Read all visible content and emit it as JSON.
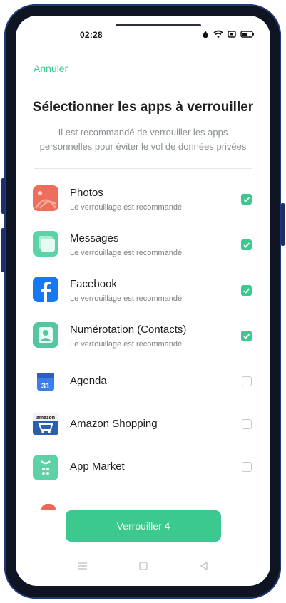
{
  "status_bar": {
    "time": "02:28"
  },
  "header": {
    "cancel_label": "Annuler",
    "title": "Sélectionner les apps à verrouiller",
    "subtitle_line1": "Il est recommandé de verrouiller les apps",
    "subtitle_line2": "personnelles pour éviter le vol de données privées"
  },
  "apps": [
    {
      "name": "Photos",
      "sub": "Le verrouillage est recommandé",
      "checked": true,
      "icon": "photos-icon",
      "color": "#ee6e5c"
    },
    {
      "name": "Messages",
      "sub": "Le verrouillage est recommandé",
      "checked": true,
      "icon": "messages-icon",
      "color": "#5dd2a6"
    },
    {
      "name": "Facebook",
      "sub": "Le verrouillage est recommandé",
      "checked": true,
      "icon": "facebook-icon",
      "color": "#1877f2"
    },
    {
      "name": "Numérotation (Contacts)",
      "sub": "Le verrouillage est recommandé",
      "checked": true,
      "icon": "contacts-icon",
      "color": "#55c7a0"
    },
    {
      "name": "Agenda",
      "checked": false,
      "icon": "calendar-icon",
      "color": "#3b7de9",
      "icon_text": "31"
    },
    {
      "name": "Amazon Shopping",
      "checked": false,
      "icon": "amazon-icon",
      "color": "#2a5fb0",
      "icon_text": "amazon"
    },
    {
      "name": "App Market",
      "checked": false,
      "icon": "app-market-icon",
      "color": "#5dd2a6"
    }
  ],
  "lock_button": {
    "label": "Verrouiller 4"
  },
  "colors": {
    "accent": "#3cc98f"
  }
}
